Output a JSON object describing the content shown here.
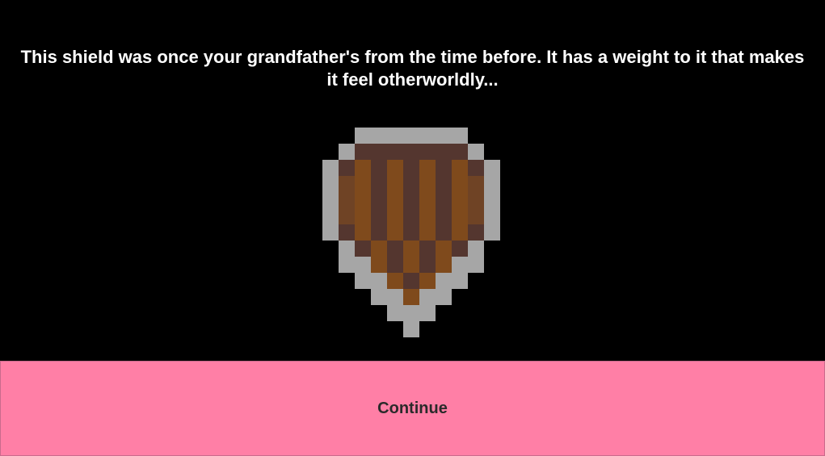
{
  "dialog": {
    "message": "This shield was once your grandfather's from the time before. It has a weight to it that makes it feel otherworldly..."
  },
  "item": {
    "icon": "wooden-shield-icon",
    "colors": {
      "rim": "#a6a6a6",
      "wood_dark": "#54362f",
      "wood_light": "#7f4a1c",
      "wood_edge": "#6f4325"
    }
  },
  "actions": {
    "continue_label": "Continue",
    "button_color": "#ff7fa6",
    "label_color": "#2a2a2a"
  }
}
